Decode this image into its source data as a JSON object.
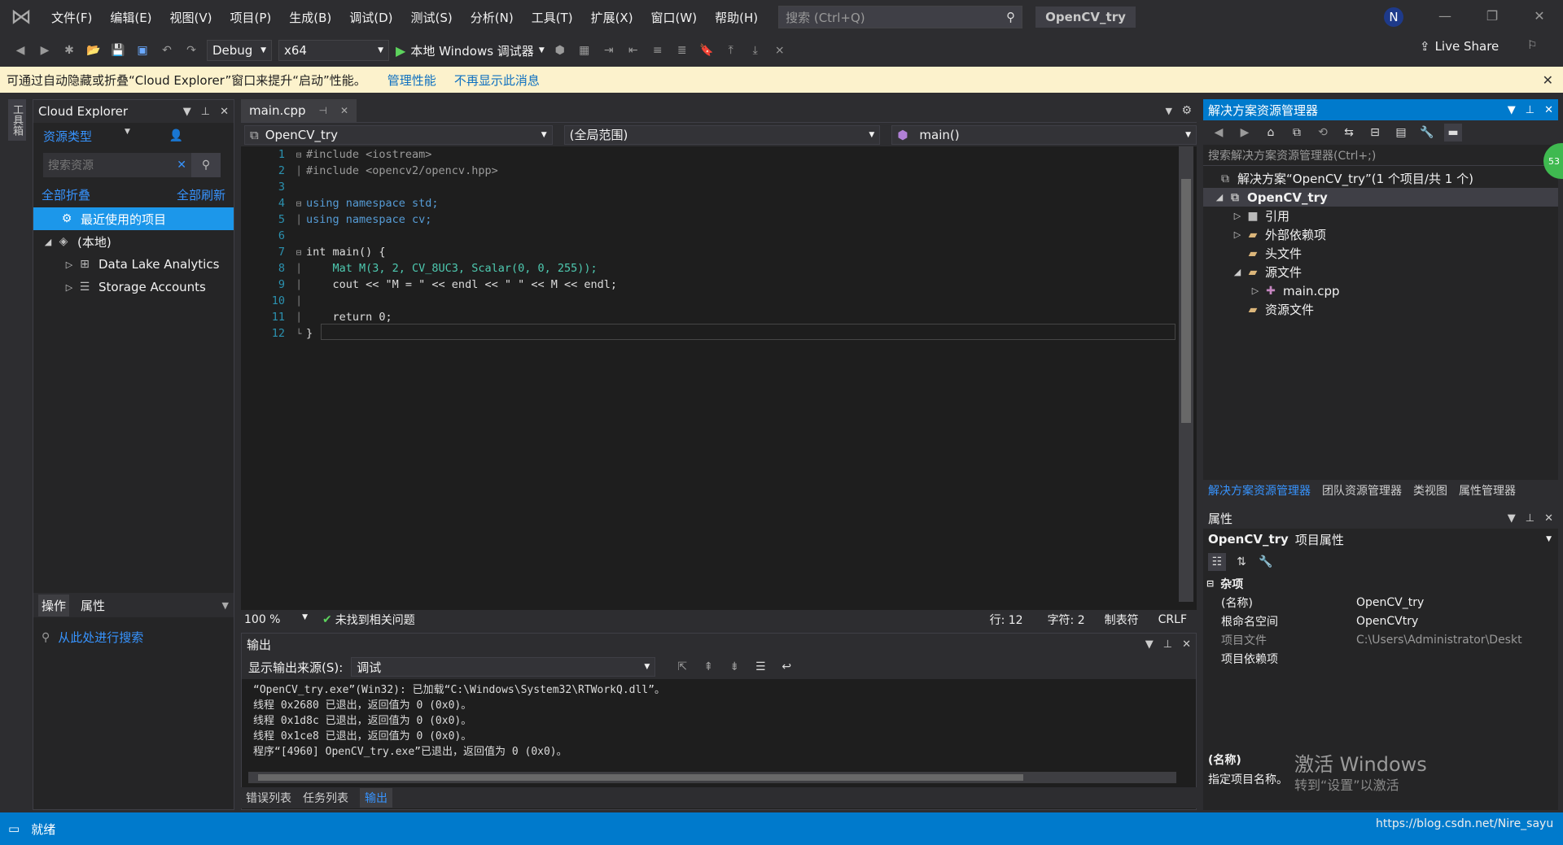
{
  "titlebar": {
    "menu": [
      "文件(F)",
      "编辑(E)",
      "视图(V)",
      "项目(P)",
      "生成(B)",
      "调试(D)",
      "测试(S)",
      "分析(N)",
      "工具(T)",
      "扩展(X)",
      "窗口(W)",
      "帮助(H)"
    ],
    "search_placeholder": "搜索 (Ctrl+Q)",
    "project_title": "OpenCV_try",
    "avatar_letter": "N"
  },
  "toolbar": {
    "config": "Debug",
    "platform": "x64",
    "run_label": "本地 Windows 调试器",
    "live_share": "Live Share"
  },
  "infobar": {
    "message": "可通过自动隐藏或折叠“Cloud Explorer”窗口来提升“启动”性能。",
    "link1": "管理性能",
    "link2": "不再显示此消息"
  },
  "toolbox_tab": "工具箱",
  "cloud_explorer": {
    "title": "Cloud Explorer",
    "resource_type": "资源类型",
    "search_placeholder": "搜索资源",
    "collapse_all": "全部折叠",
    "refresh_all": "全部刷新",
    "items": [
      {
        "label": "最近使用的项目"
      },
      {
        "label": "(本地)"
      },
      {
        "label": "Data Lake Analytics"
      },
      {
        "label": "Storage Accounts"
      }
    ],
    "tabs": [
      "操作",
      "属性"
    ],
    "search_here": "从此处进行搜索"
  },
  "editor": {
    "tab_name": "main.cpp",
    "nav_project": "OpenCV_try",
    "nav_scope": "(全局范围)",
    "nav_member": "main()",
    "zoom": "100 %",
    "issues": "未找到相关问题",
    "line": "行: 12",
    "col": "字符: 2",
    "tab_mode": "制表符",
    "eol": "CRLF"
  },
  "code": [
    "#include <iostream>",
    "#include <opencv2/opencv.hpp>",
    "",
    "using namespace std;",
    "using namespace cv;",
    "",
    "int main() {",
    "    Mat M(3, 2, CV_8UC3, Scalar(0, 0, 255));",
    "    cout << \"M = \" << endl << \" \" << M << endl;",
    "",
    "    return 0;",
    "}"
  ],
  "output": {
    "title": "输出",
    "source_label": "显示输出来源(S):",
    "source_value": "调试",
    "lines": [
      "“OpenCV_try.exe”(Win32): 已加载“C:\\Windows\\System32\\RTWorkQ.dll”。",
      "线程 0x2680 已退出，返回值为 0 (0x0)。",
      "线程 0x1d8c 已退出，返回值为 0 (0x0)。",
      "线程 0x1ce8 已退出，返回值为 0 (0x0)。",
      "程序“[4960] OpenCV_try.exe”已退出，返回值为 0 (0x0)。"
    ],
    "tabs": [
      "错误列表",
      "任务列表",
      "输出"
    ]
  },
  "solution": {
    "title": "解决方案资源管理器",
    "search_placeholder": "搜索解决方案资源管理器(Ctrl+;)",
    "badge": "53",
    "tree": [
      {
        "label": "解决方案“OpenCV_try”(1 个项目/共 1 个)"
      },
      {
        "label": "OpenCV_try"
      },
      {
        "label": "引用"
      },
      {
        "label": "外部依赖项"
      },
      {
        "label": "头文件"
      },
      {
        "label": "源文件"
      },
      {
        "label": "main.cpp"
      },
      {
        "label": "资源文件"
      }
    ],
    "tabs": [
      "解决方案资源管理器",
      "团队资源管理器",
      "类视图",
      "属性管理器"
    ]
  },
  "properties": {
    "title": "属性",
    "object": "OpenCV_try",
    "object_type": "项目属性",
    "category": "杂项",
    "rows": [
      {
        "k": "(名称)",
        "v": "OpenCV_try"
      },
      {
        "k": "根命名空间",
        "v": "OpenCVtry"
      },
      {
        "k": "项目文件",
        "v": "C:\\Users\\Administrator\\Deskt"
      },
      {
        "k": "项目依赖项",
        "v": ""
      }
    ],
    "desc_title": "(名称)",
    "desc_text": "指定项目名称。"
  },
  "overlay": {
    "activate": "激活 Windows",
    "activate_sub": "转到“设置”以激活",
    "blog": "https://blog.csdn.net/Nire_sayu"
  },
  "status": {
    "ready": "就绪"
  }
}
